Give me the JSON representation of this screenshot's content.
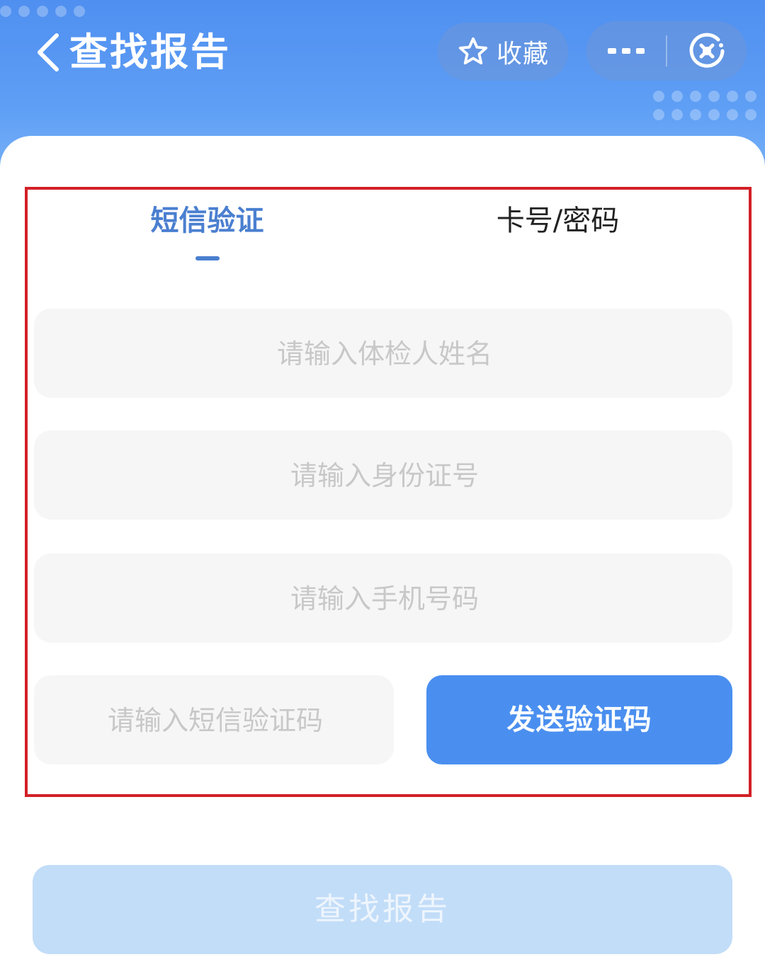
{
  "header": {
    "title": "查找报告",
    "favorite_label": "收藏"
  },
  "tabs": [
    {
      "label": "短信验证",
      "active": true
    },
    {
      "label": "卡号/密码",
      "active": false
    }
  ],
  "form": {
    "name_placeholder": "请输入体检人姓名",
    "id_placeholder": "请输入身份证号",
    "phone_placeholder": "请输入手机号码",
    "code_placeholder": "请输入短信验证码",
    "send_code_label": "发送验证码",
    "submit_label": "查找报告"
  },
  "icons": {
    "back": "chevron-left-icon",
    "favorite": "star-icon",
    "more": "more-dots-icon",
    "close": "close-target-icon"
  },
  "colors": {
    "header_blue": "#4f8ff0",
    "accent_blue": "#4a8ff0",
    "active_tab": "#4a7fd0",
    "highlight_red": "#d32027",
    "disabled_button": "#c2ddf8"
  }
}
